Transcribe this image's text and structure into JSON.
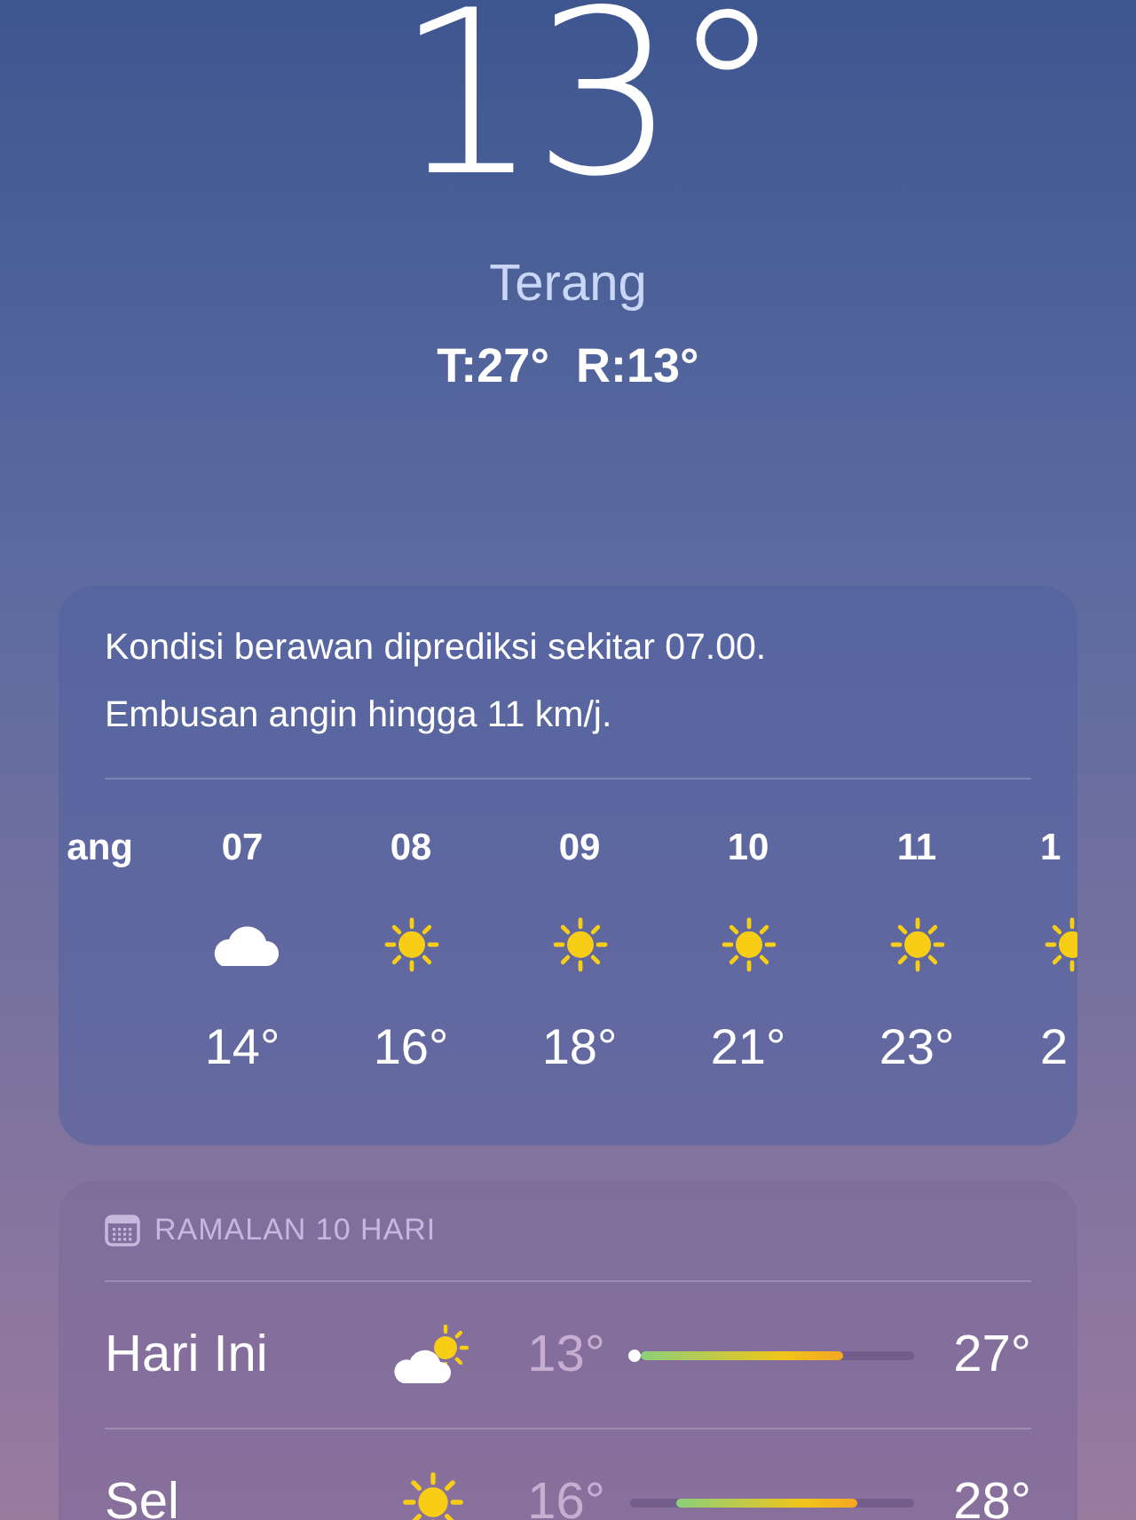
{
  "current": {
    "temperature": "13°",
    "condition": "Terang",
    "high_low": "T:27°  R:13°"
  },
  "hourly_card": {
    "summary_lines": [
      "Kondisi berawan diprediksi sekitar 07.00.",
      "Embusan angin hingga 11 km/j."
    ],
    "hours": [
      {
        "time": "ang",
        "kind": "partial"
      },
      {
        "time": "07",
        "kind": "cloud",
        "temp": "14°"
      },
      {
        "time": "08",
        "kind": "sun",
        "temp": "16°"
      },
      {
        "time": "09",
        "kind": "sun",
        "temp": "18°"
      },
      {
        "time": "10",
        "kind": "sun",
        "temp": "21°"
      },
      {
        "time": "11",
        "kind": "sun",
        "temp": "23°"
      },
      {
        "time": "1",
        "kind": "sun",
        "temp": "2"
      }
    ]
  },
  "daily_card": {
    "title": "RAMALAN 10 HARI",
    "days": [
      {
        "day": "Hari Ini",
        "kind": "partly-cloudy",
        "low": "13°",
        "high": "27°",
        "current_marker": true
      },
      {
        "day": "Sel",
        "kind": "sun",
        "low": "16°",
        "high": "28°",
        "current_marker": false
      }
    ]
  }
}
